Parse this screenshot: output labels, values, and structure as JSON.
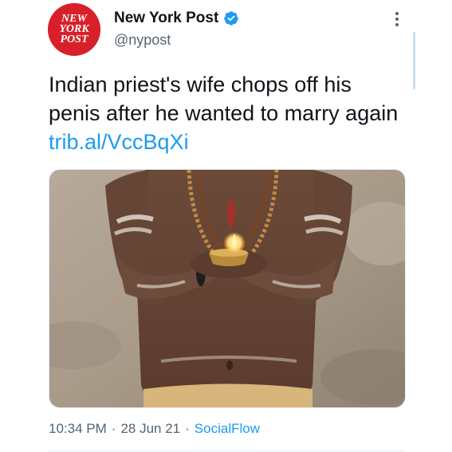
{
  "account": {
    "display_name": "New York Post",
    "handle": "@nypost",
    "avatar_text": [
      "NEW",
      "YORK",
      "POST"
    ],
    "verified": true
  },
  "tweet": {
    "text_lines": [
      "Indian priest's wife chops off his",
      "penis after he wanted to marry again"
    ],
    "link": "trib.al/VccBqXi",
    "media": {
      "icon": "photo-priest-holding-oil-lamp"
    }
  },
  "meta": {
    "time": "10:34 PM",
    "separator": "·",
    "date": "28 Jun 21",
    "source": "SocialFlow"
  },
  "icons": {
    "more": "more-vertical-icon",
    "verified": "verified-badge-icon"
  },
  "colors": {
    "link": "#1d9bf0",
    "avatar_bg": "#d8202a",
    "text": "#0f1419",
    "secondary": "#536471"
  }
}
